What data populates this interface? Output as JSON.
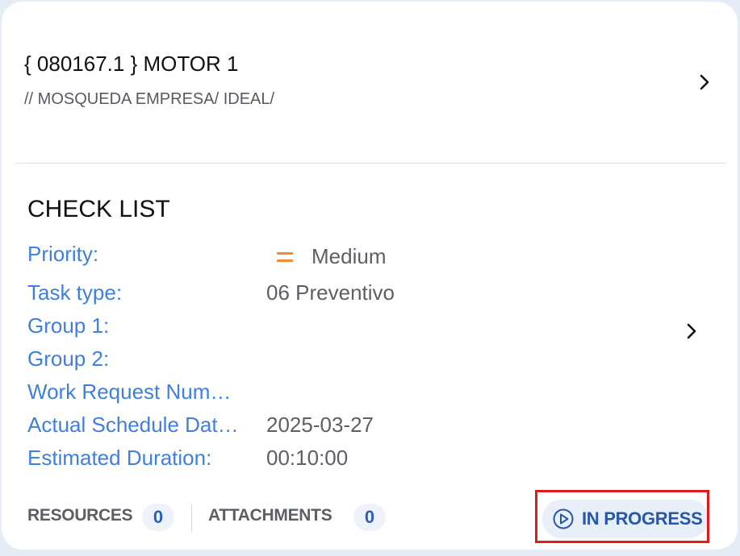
{
  "asset": {
    "title": "{ 080167.1 } MOTOR 1",
    "path": "// MOSQUEDA EMPRESA/ IDEAL/"
  },
  "task": {
    "title": "CHECK LIST",
    "fields": [
      {
        "label": "Priority:",
        "value": "Medium"
      },
      {
        "label": "Task type:",
        "value": "06 Preventivo"
      },
      {
        "label": "Group 1:",
        "value": ""
      },
      {
        "label": "Group 2:",
        "value": ""
      },
      {
        "label": "Work Request Num…",
        "value": ""
      },
      {
        "label": "Actual Schedule Dat…",
        "value": "2025-03-27"
      },
      {
        "label": "Estimated Duration:",
        "value": "00:10:00"
      }
    ],
    "priority_icon": "equals-icon",
    "priority_color": "#f08a2a"
  },
  "footer": {
    "resources_label": "RESOURCES",
    "resources_count": "0",
    "attachments_label": "ATTACHMENTS",
    "attachments_count": "0",
    "status_label": "IN PROGRESS",
    "status_icon": "play-circle-icon"
  },
  "colors": {
    "label_blue": "#3f7fe0",
    "status_blue": "#2757a8",
    "highlight_red": "#e01b1b"
  }
}
